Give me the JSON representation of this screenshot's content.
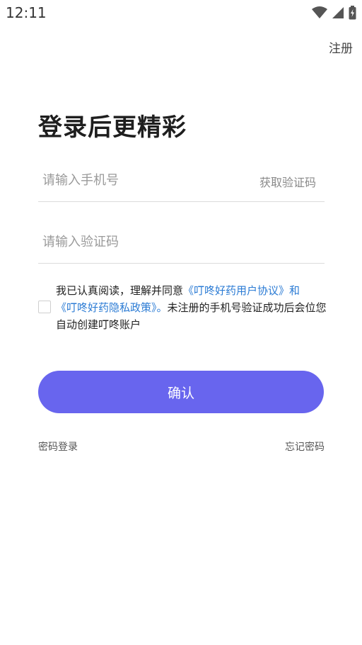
{
  "status_bar": {
    "time": "12:11"
  },
  "header": {
    "register_label": "注册"
  },
  "title": "登录后更精彩",
  "phone": {
    "placeholder": "请输入手机号",
    "value": ""
  },
  "get_code_label": "获取验证码",
  "code": {
    "placeholder": "请输入验证码",
    "value": ""
  },
  "agreement": {
    "checked": false,
    "prefix": "我已认真阅读，理解并同意",
    "user_agreement": "《叮咚好药用户协议》",
    "conjunction": "和",
    "privacy_policy": "《叮咚好药隐私政策》。",
    "suffix": "未注册的手机号验证成功后会位您自动创建叮咚账户"
  },
  "confirm_label": "确认",
  "password_login_label": "密码登录",
  "forgot_password_label": "忘记密码",
  "colors": {
    "accent": "#6865ee",
    "link": "#2b7bd4"
  }
}
